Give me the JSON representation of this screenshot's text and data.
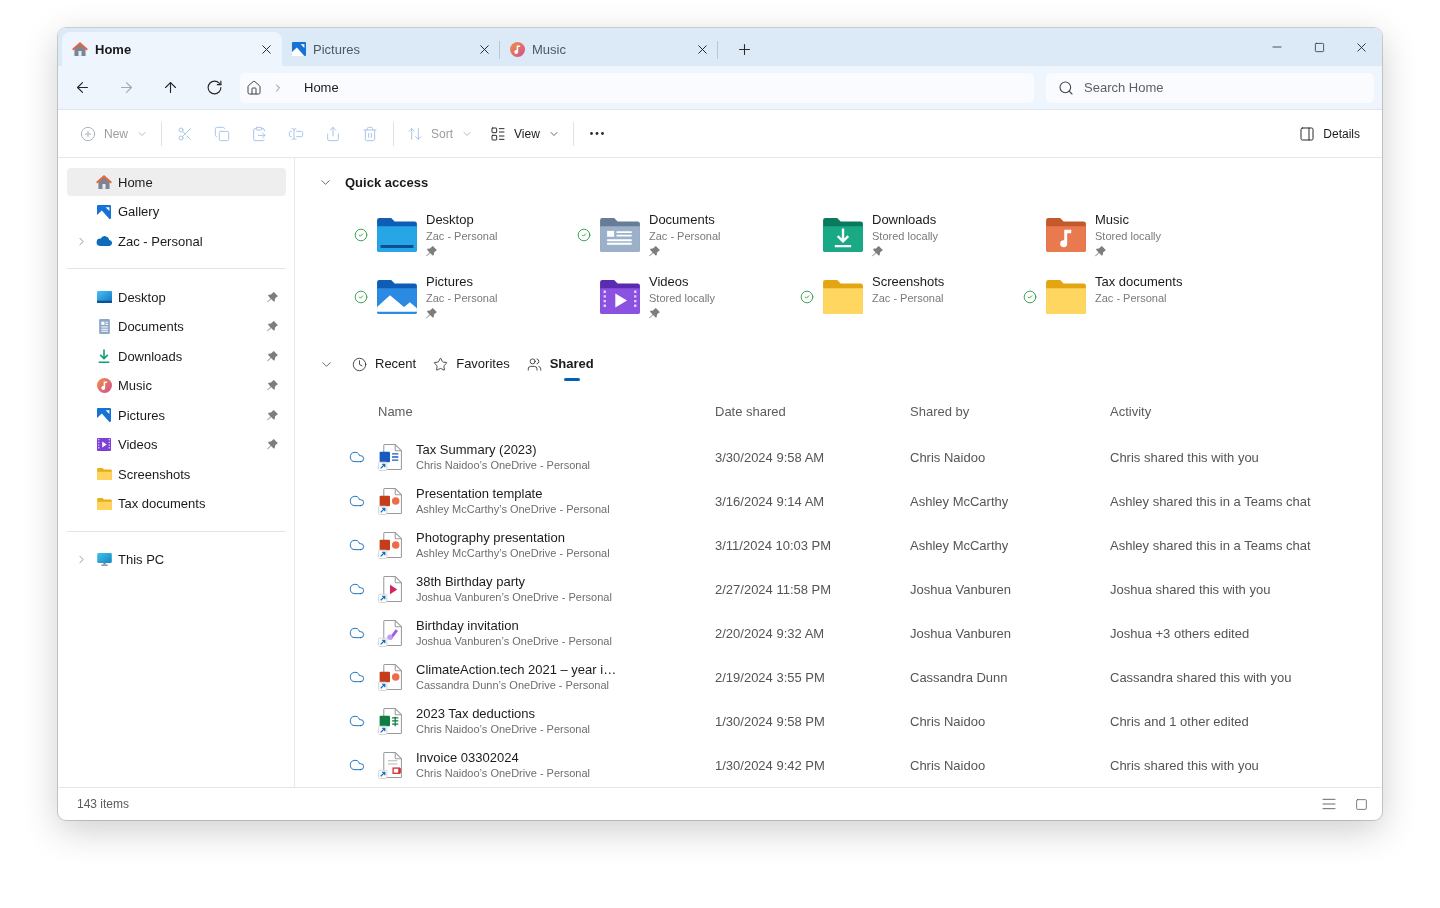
{
  "window": {
    "tabs": [
      {
        "label": "Home",
        "selected": true
      },
      {
        "label": "Pictures",
        "selected": false
      },
      {
        "label": "Music",
        "selected": false
      }
    ]
  },
  "navigation": {
    "buttons": [
      {
        "disabled": false
      },
      {
        "disabled": true
      },
      {
        "disabled": false
      },
      {
        "disabled": false
      }
    ],
    "address": {
      "crumbs": [
        "Home"
      ]
    },
    "search": {
      "placeholder": "Search Home"
    }
  },
  "toolbar": {
    "groups": [
      [
        {
          "label": "New",
          "disabled": true,
          "dropdown": true
        }
      ],
      [
        {
          "disabled": true
        },
        {
          "disabled": true
        },
        {
          "disabled": true
        },
        {
          "disabled": true
        },
        {
          "disabled": true
        },
        {
          "disabled": true
        }
      ],
      [
        {
          "label": "Sort",
          "disabled": true,
          "dropdown": true
        },
        {
          "label": "View",
          "disabled": false,
          "dropdown": true
        }
      ],
      [
        {
          "disabled": false
        }
      ]
    ],
    "details": {
      "label": "Details"
    }
  },
  "sidebar": {
    "groups": [
      [
        {
          "label": "Home",
          "selected": true,
          "pinned": false
        },
        {
          "label": "Gallery",
          "selected": false,
          "pinned": false
        },
        {
          "label": "Zac - Personal",
          "selected": false,
          "pinned": false,
          "expanded": false
        }
      ],
      [
        {
          "label": "Desktop",
          "selected": false,
          "pinned": true
        },
        {
          "label": "Documents",
          "selected": false,
          "pinned": true
        },
        {
          "label": "Downloads",
          "selected": false,
          "pinned": true
        },
        {
          "label": "Music",
          "selected": false,
          "pinned": true
        },
        {
          "label": "Pictures",
          "selected": false,
          "pinned": true
        },
        {
          "label": "Videos",
          "selected": false,
          "pinned": true
        },
        {
          "label": "Screenshots",
          "selected": false,
          "pinned": false
        },
        {
          "label": "Tax documents",
          "selected": false,
          "pinned": false
        }
      ],
      [
        {
          "label": "This PC",
          "selected": false,
          "pinned": false,
          "expanded": false
        }
      ]
    ]
  },
  "quick_access": {
    "title": "Quick access",
    "expanded": true,
    "items": [
      {
        "name": "Desktop",
        "location": "Zac - Personal",
        "synced": true,
        "pinned": true
      },
      {
        "name": "Documents",
        "location": "Zac - Personal",
        "synced": true,
        "pinned": true
      },
      {
        "name": "Downloads",
        "location": "Stored locally",
        "synced": false,
        "pinned": true
      },
      {
        "name": "Music",
        "location": "Stored locally",
        "synced": false,
        "pinned": true
      },
      {
        "name": "Pictures",
        "location": "Zac - Personal",
        "synced": true,
        "pinned": true
      },
      {
        "name": "Videos",
        "location": "Stored locally",
        "synced": false,
        "pinned": true
      },
      {
        "name": "Screenshots",
        "location": "Zac - Personal",
        "synced": true,
        "pinned": false
      },
      {
        "name": "Tax documents",
        "location": "Zac - Personal",
        "synced": true,
        "pinned": false
      }
    ]
  },
  "activity": {
    "expanded": true,
    "tabs": [
      {
        "label": "Recent",
        "selected": false
      },
      {
        "label": "Favorites",
        "selected": false
      },
      {
        "label": "Shared",
        "selected": true
      }
    ],
    "table": {
      "columns": [
        "Name",
        "Date shared",
        "Shared by",
        "Activity"
      ],
      "rows": [
        {
          "name": "Tax Summary (2023)",
          "location": "Chris Naidoo’s OneDrive - Personal",
          "date": "3/30/2024 9:58 AM",
          "shared_by": "Chris Naidoo",
          "activity": "Chris shared this with you"
        },
        {
          "name": "Presentation template",
          "location": "Ashley McCarthy’s OneDrive - Personal",
          "date": "3/16/2024 9:14 AM",
          "shared_by": "Ashley McCarthy",
          "activity": "Ashley shared this in a Teams chat"
        },
        {
          "name": "Photography presentation",
          "location": "Ashley McCarthy’s OneDrive - Personal",
          "date": "3/11/2024 10:03 PM",
          "shared_by": "Ashley McCarthy",
          "activity": "Ashley shared this in a Teams chat"
        },
        {
          "name": "38th Birthday party",
          "location": "Joshua Vanburen’s OneDrive - Personal",
          "date": "2/27/2024 11:58 PM",
          "shared_by": "Joshua Vanburen",
          "activity": "Joshua shared this with you"
        },
        {
          "name": "Birthday invitation",
          "location": "Joshua Vanburen’s OneDrive - Personal",
          "date": "2/20/2024 9:32 AM",
          "shared_by": "Joshua Vanburen",
          "activity": "Joshua +3 others edited"
        },
        {
          "name": "ClimateAction.tech 2021 – year i…",
          "location": "Cassandra Dunn’s OneDrive - Personal",
          "date": "2/19/2024 3:55 PM",
          "shared_by": "Cassandra Dunn",
          "activity": "Cassandra shared this with you"
        },
        {
          "name": "2023 Tax deductions",
          "location": "Chris Naidoo’s OneDrive - Personal",
          "date": "1/30/2024 9:58 PM",
          "shared_by": "Chris Naidoo",
          "activity": "Chris and 1 other edited"
        },
        {
          "name": "Invoice 03302024",
          "location": "Chris Naidoo’s OneDrive - Personal",
          "date": "1/30/2024 9:42 PM",
          "shared_by": "Chris Naidoo",
          "activity": "Chris shared this with you"
        }
      ]
    }
  },
  "status_bar": {
    "item_count": "143 items"
  }
}
